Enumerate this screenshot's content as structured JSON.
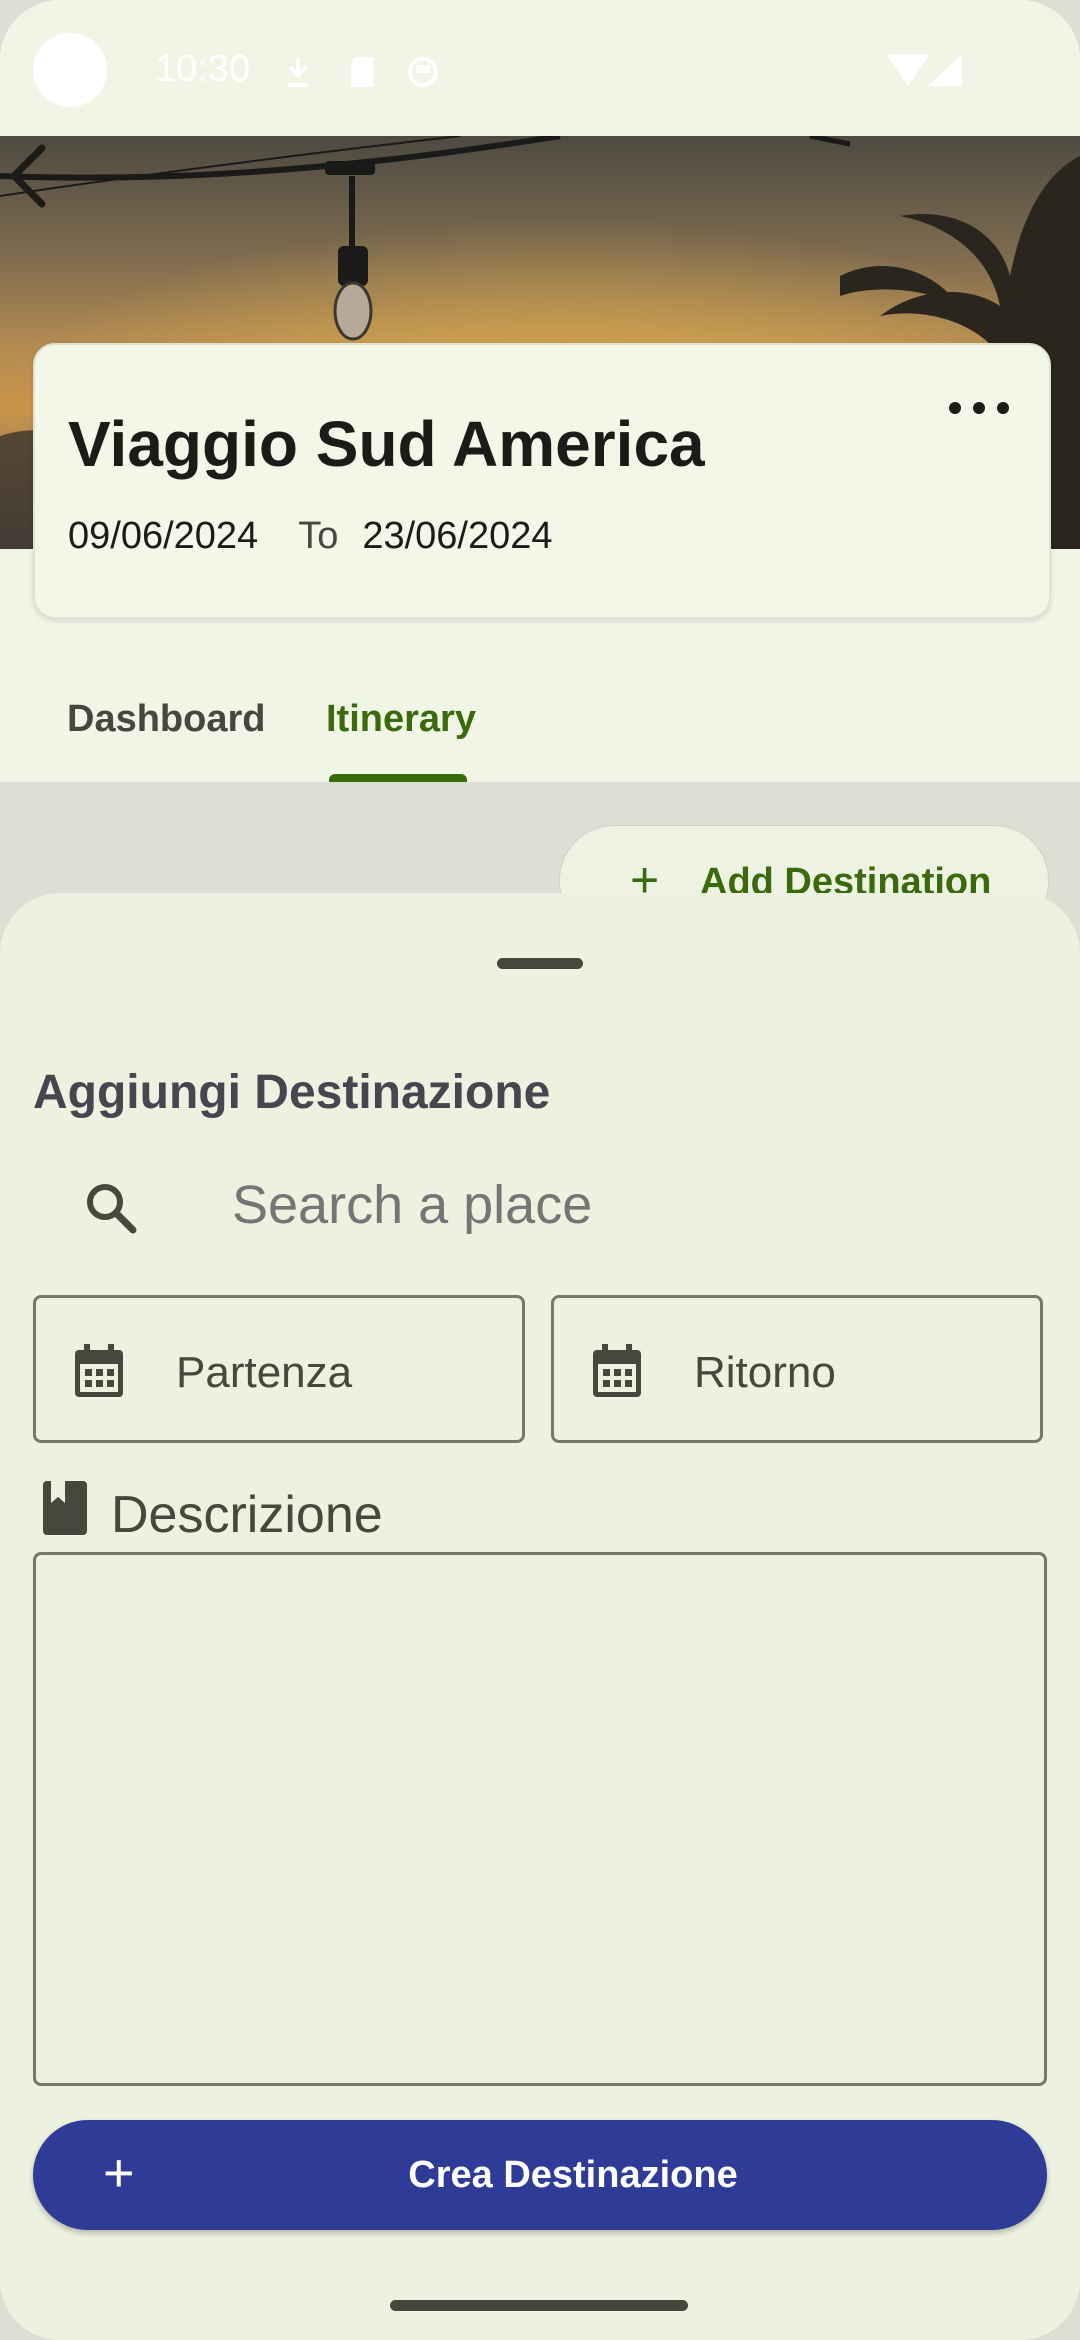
{
  "status_bar": {
    "time": "10:30"
  },
  "trip": {
    "title": "Viaggio Sud America",
    "start_date": "09/06/2024",
    "to_label": "To",
    "end_date": "23/06/2024"
  },
  "tabs": [
    {
      "label": "Dashboard",
      "selected": false
    },
    {
      "label": "Itinerary",
      "selected": true
    }
  ],
  "add_destination_button": {
    "label": "Add Destination"
  },
  "sheet": {
    "title": "Aggiungi Destinazione",
    "search_placeholder": "Search a place",
    "departure_label": "Partenza",
    "return_label": "Ritorno",
    "description_label": "Descrizione",
    "description_value": "",
    "create_button_label": "Crea Destinazione"
  },
  "colors": {
    "accent_green": "#3a6a0c",
    "primary_button": "#2e3c98",
    "surface": "#edf1df"
  }
}
